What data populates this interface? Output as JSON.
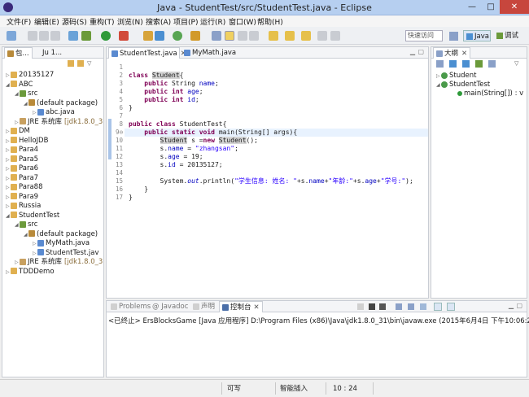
{
  "window": {
    "title": "Java - StudentTest/src/StudentTest.java - Eclipse",
    "minimize": "—",
    "maximize": "□",
    "close": "✕"
  },
  "menu": [
    "文件(F)",
    "编辑(E)",
    "源码(S)",
    "重构(T)",
    "浏览(N)",
    "搜索(A)",
    "项目(P)",
    "运行(R)",
    "窗口(W)",
    "帮助(H)"
  ],
  "toolbar": {
    "quick_access": "快速访问",
    "java_perspective": "Java",
    "debug_perspective": "调试"
  },
  "explorer": {
    "tabs": [
      "包...",
      "Ju 1..."
    ],
    "items": [
      {
        "label": "20135127",
        "level": 0,
        "icon": "project-icon",
        "arrow": "▷"
      },
      {
        "label": "ABC",
        "level": 0,
        "icon": "project-icon",
        "arrow": "◢"
      },
      {
        "label": "src",
        "level": 1,
        "icon": "source-folder-icon",
        "arrow": "◢"
      },
      {
        "label": "(default package)",
        "level": 2,
        "icon": "package-icon",
        "arrow": "◢"
      },
      {
        "label": "abc.java",
        "level": 3,
        "icon": "java-file-icon",
        "arrow": "▷"
      },
      {
        "label": "JRE 系统库",
        "extra": "[jdk1.8.0_3",
        "level": 1,
        "icon": "library-icon",
        "arrow": "▷"
      },
      {
        "label": "DM",
        "level": 0,
        "icon": "project-icon",
        "arrow": "▷"
      },
      {
        "label": "HelloJDB",
        "level": 0,
        "icon": "project-icon",
        "arrow": "▷"
      },
      {
        "label": "Para4",
        "level": 0,
        "icon": "project-icon",
        "arrow": "▷"
      },
      {
        "label": "Para5",
        "level": 0,
        "icon": "project-icon",
        "arrow": "▷"
      },
      {
        "label": "Para6",
        "level": 0,
        "icon": "project-icon",
        "arrow": "▷"
      },
      {
        "label": "Para7",
        "level": 0,
        "icon": "project-icon",
        "arrow": "▷"
      },
      {
        "label": "Para88",
        "level": 0,
        "icon": "project-icon",
        "arrow": "▷"
      },
      {
        "label": "Para9",
        "level": 0,
        "icon": "project-icon",
        "arrow": "▷"
      },
      {
        "label": "Russia",
        "level": 0,
        "icon": "project-icon",
        "arrow": "▷"
      },
      {
        "label": "StudentTest",
        "level": 0,
        "icon": "project-icon",
        "arrow": "◢"
      },
      {
        "label": "src",
        "level": 1,
        "icon": "source-folder-icon",
        "arrow": "◢"
      },
      {
        "label": "(default package)",
        "level": 2,
        "icon": "package-icon",
        "arrow": "◢"
      },
      {
        "label": "MyMath.java",
        "level": 3,
        "icon": "java-file-icon",
        "arrow": "▷"
      },
      {
        "label": "StudentTest.jav",
        "level": 3,
        "icon": "java-file-icon",
        "arrow": "▷"
      },
      {
        "label": "JRE 系统库",
        "extra": "[jdk1.8.0_3",
        "level": 1,
        "icon": "library-icon",
        "arrow": "▷"
      },
      {
        "label": "TDDDemo",
        "level": 0,
        "icon": "project-icon",
        "arrow": "▷"
      }
    ]
  },
  "editor": {
    "tabs": [
      {
        "label": "StudentTest.java",
        "active": true
      },
      {
        "label": "MyMath.java",
        "active": false
      }
    ],
    "line_numbers": [
      "1",
      "2",
      "3",
      "4",
      "5",
      "6",
      "7",
      "8",
      "9⊖",
      "10",
      "11",
      "12",
      "13",
      "14",
      "15",
      "16",
      "17"
    ],
    "highlight_line": 10
  },
  "outline": {
    "tab": "大纲",
    "items": [
      {
        "label": "Student",
        "level": 0,
        "arrow": "▷"
      },
      {
        "label": "StudentTest",
        "level": 0,
        "arrow": "◢"
      },
      {
        "label": "main(String[]) : v",
        "level": 1,
        "arrow": ""
      }
    ]
  },
  "console": {
    "tabs": [
      "Problems",
      "@ Javadoc",
      "声明",
      "控制台"
    ],
    "line": "<已终止> ErsBlocksGame [Java 应用程序] D:\\Program Files (x86)\\Java\\jdk1.8.0_31\\bin\\javaw.exe (2015年6月4日 下午10:06:25)"
  },
  "status": {
    "writable": "可写",
    "insert_mode": "智能插入",
    "position": "10 : 24"
  }
}
